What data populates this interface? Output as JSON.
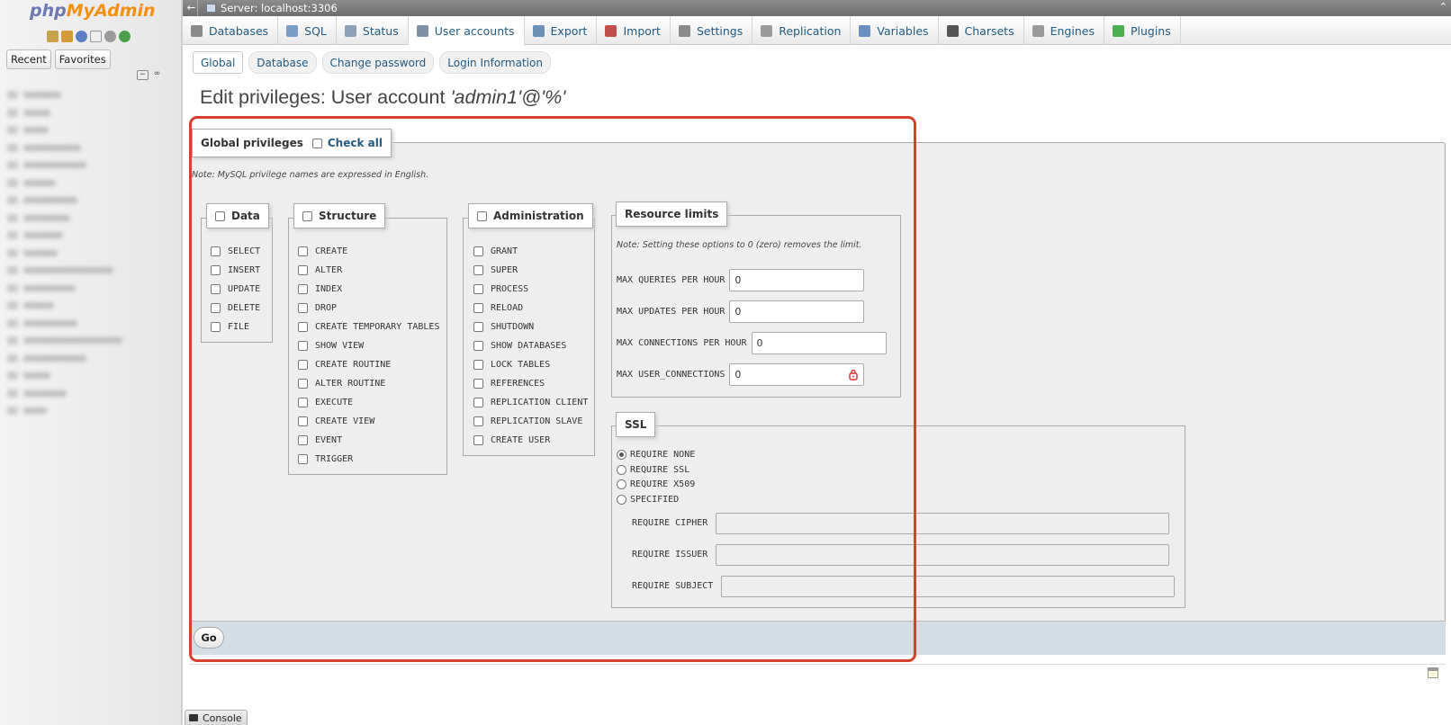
{
  "sidebar": {
    "logo_php": "php",
    "logo_myadmin": "MyAdmin",
    "quick_icons": [
      "home-icon",
      "database-icon",
      "help-icon",
      "document-icon",
      "gear-icon",
      "reload-icon"
    ],
    "tabs": {
      "recent": "Recent",
      "favorites": "Favorites"
    },
    "controls": {
      "collapse": "−",
      "link": "∞"
    },
    "tree_items": [
      42,
      30,
      28,
      64,
      70,
      36,
      60,
      52,
      44,
      38,
      100,
      58,
      34,
      60,
      110,
      70,
      30,
      48,
      26
    ]
  },
  "serverbar": {
    "back": "←",
    "title": "Server: localhost:3306",
    "collapse": "⌃"
  },
  "main_tabs": [
    {
      "label": "Databases",
      "icon": "database-icon",
      "color": "#8a8a8a"
    },
    {
      "label": "SQL",
      "icon": "sql-icon",
      "color": "#7a9cc6"
    },
    {
      "label": "Status",
      "icon": "status-icon",
      "color": "#8ea0b8"
    },
    {
      "label": "User accounts",
      "icon": "users-icon",
      "color": "#7f8fa6",
      "active": true
    },
    {
      "label": "Export",
      "icon": "export-icon",
      "color": "#6b8fb5"
    },
    {
      "label": "Import",
      "icon": "import-icon",
      "color": "#c0504d"
    },
    {
      "label": "Settings",
      "icon": "wrench-icon",
      "color": "#8b8b8b"
    },
    {
      "label": "Replication",
      "icon": "replication-icon",
      "color": "#9b9b9b"
    },
    {
      "label": "Variables",
      "icon": "variables-icon",
      "color": "#6a8fc0"
    },
    {
      "label": "Charsets",
      "icon": "charsets-icon",
      "color": "#555555"
    },
    {
      "label": "Engines",
      "icon": "engines-icon",
      "color": "#9a9a9a"
    },
    {
      "label": "Plugins",
      "icon": "plugin-icon",
      "color": "#4caf50"
    }
  ],
  "sub_tabs": [
    "Global",
    "Database",
    "Change password",
    "Login Information"
  ],
  "page_title": {
    "prefix": "Edit privileges: User account ",
    "account": "'admin1'@'%'"
  },
  "global": {
    "legend": "Global privileges",
    "check_all": "Check all",
    "note": "Note: MySQL privilege names are expressed in English."
  },
  "groups": {
    "data": {
      "legend": "Data",
      "items": [
        "SELECT",
        "INSERT",
        "UPDATE",
        "DELETE",
        "FILE"
      ]
    },
    "structure": {
      "legend": "Structure",
      "items": [
        "CREATE",
        "ALTER",
        "INDEX",
        "DROP",
        "CREATE TEMPORARY TABLES",
        "SHOW VIEW",
        "CREATE ROUTINE",
        "ALTER ROUTINE",
        "EXECUTE",
        "CREATE VIEW",
        "EVENT",
        "TRIGGER"
      ]
    },
    "administration": {
      "legend": "Administration",
      "items": [
        "GRANT",
        "SUPER",
        "PROCESS",
        "RELOAD",
        "SHUTDOWN",
        "SHOW DATABASES",
        "LOCK TABLES",
        "REFERENCES",
        "REPLICATION CLIENT",
        "REPLICATION SLAVE",
        "CREATE USER"
      ]
    }
  },
  "resource_limits": {
    "legend": "Resource limits",
    "note": "Note: Setting these options to 0 (zero) removes the limit.",
    "max_queries_label": "MAX QUERIES PER HOUR",
    "max_queries_value": "0",
    "max_updates_label": "MAX UPDATES PER HOUR",
    "max_updates_value": "0",
    "max_connections_label": "MAX CONNECTIONS PER HOUR",
    "max_connections_value": "0",
    "max_user_connections_label": "MAX USER_CONNECTIONS",
    "max_user_connections_value": "0"
  },
  "ssl": {
    "legend": "SSL",
    "options": [
      "REQUIRE NONE",
      "REQUIRE SSL",
      "REQUIRE X509",
      "SPECIFIED"
    ],
    "selected": "REQUIRE NONE",
    "cipher_label": "REQUIRE CIPHER",
    "issuer_label": "REQUIRE ISSUER",
    "subject_label": "REQUIRE SUBJECT"
  },
  "go_label": "Go",
  "console_label": "Console",
  "colors": {
    "link": "#235a81",
    "highlight": "#d8402e",
    "logo_php": "#6c78af",
    "logo_myadmin": "#f29111"
  }
}
